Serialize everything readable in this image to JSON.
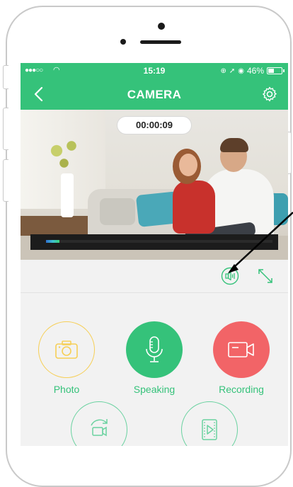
{
  "status_bar": {
    "signal": "●●●○○",
    "time": "15:19",
    "battery_percent": "46%",
    "battery_level": 0.46
  },
  "nav": {
    "title": "CAMERA",
    "back_icon": "chevron-left-icon",
    "settings_icon": "gear-icon"
  },
  "video": {
    "timer": "00:00:09",
    "progress": 0.06
  },
  "controls": {
    "sound_icon": "speaker-icon",
    "fullscreen_icon": "expand-icon"
  },
  "actions": [
    {
      "label": "Photo",
      "icon": "camera-icon",
      "color": "#f6cf56"
    },
    {
      "label": "Speaking",
      "icon": "microphone-icon",
      "color": "#35c27a"
    },
    {
      "label": "Recording",
      "icon": "video-camera-icon",
      "color": "#f26467"
    }
  ],
  "secondary_actions": [
    {
      "icon": "rotate-camera-icon"
    },
    {
      "icon": "video-playback-icon"
    }
  ],
  "colors": {
    "brand_green": "#35c27a",
    "photo_yellow": "#f6cf56",
    "record_red": "#f26467"
  }
}
